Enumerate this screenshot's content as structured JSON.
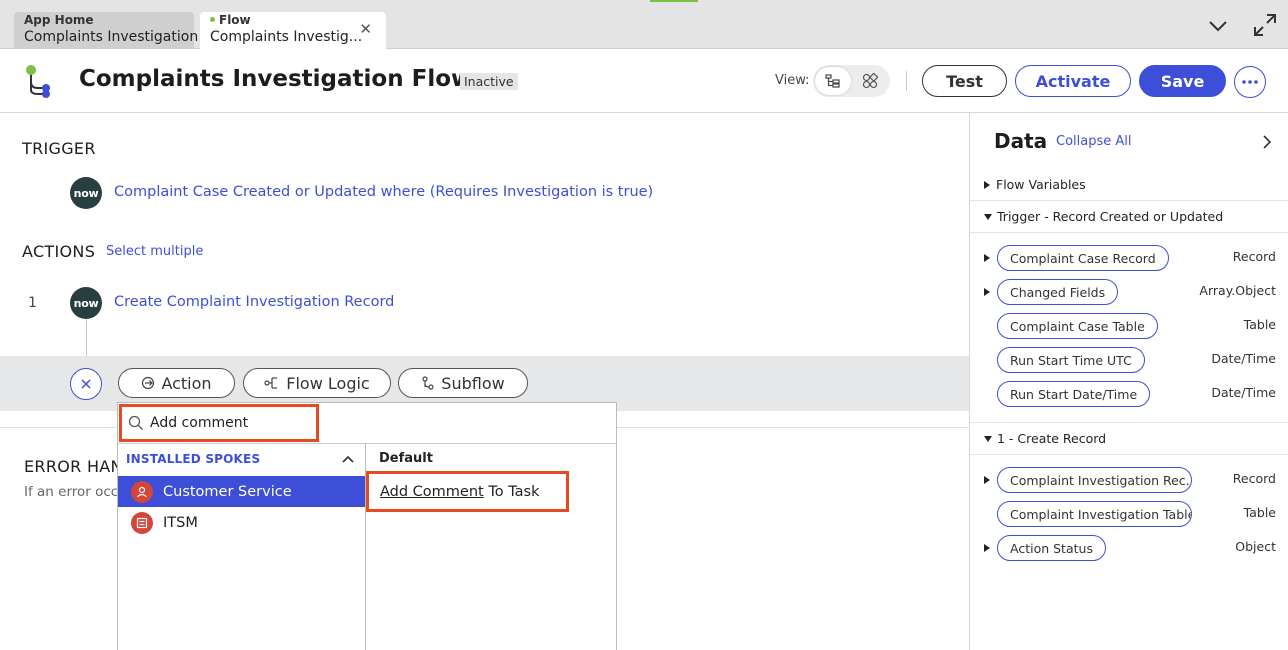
{
  "tabs": [
    {
      "title": "App Home",
      "subtitle": "Complaints Investigation"
    },
    {
      "title": "Flow",
      "subtitle": "Complaints Investig..."
    }
  ],
  "header": {
    "title": "Complaints Investigation Flow",
    "status": "Inactive",
    "view_label": "View:",
    "buttons": {
      "test": "Test",
      "activate": "Activate",
      "save": "Save"
    }
  },
  "trigger": {
    "section": "TRIGGER",
    "badge": "now",
    "label": "Complaint Case Created or Updated where (Requires Investigation is true)"
  },
  "actions": {
    "section": "ACTIONS",
    "select_multiple": "Select multiple",
    "items": [
      {
        "number": "1",
        "badge": "now",
        "label": "Create Complaint Investigation Record"
      }
    ]
  },
  "add_bar": {
    "action": "Action",
    "flow_logic": "Flow Logic",
    "subflow": "Subflow"
  },
  "error_handler": {
    "title": "ERROR HAND",
    "desc": "If an error occ"
  },
  "picker": {
    "search_value": "Add comment",
    "spokes_header": "INSTALLED SPOKES",
    "spokes": [
      "Customer Service",
      "ITSM"
    ],
    "default_header": "Default",
    "result_match": "Add Comment",
    "result_rest": " To Task"
  },
  "data_panel": {
    "title": "Data",
    "collapse_all": "Collapse All",
    "groups": {
      "flow_variables": "Flow Variables",
      "trigger": "Trigger - Record Created or Updated",
      "create_record": "1 - Create Record"
    },
    "trigger_fields": [
      {
        "name": "Complaint Case Record",
        "type": "Record"
      },
      {
        "name": "Changed Fields",
        "type": "Array.Object"
      },
      {
        "name": "Complaint Case Table",
        "type": "Table"
      },
      {
        "name": "Run Start Time UTC",
        "type": "Date/Time"
      },
      {
        "name": "Run Start Date/Time",
        "type": "Date/Time"
      }
    ],
    "create_fields": [
      {
        "name": "Complaint Investigation Rec...",
        "type": "Record"
      },
      {
        "name": "Complaint Investigation Table",
        "type": "Table"
      },
      {
        "name": "Action Status",
        "type": "Object"
      }
    ]
  },
  "colors": {
    "accent": "#3d4fd8",
    "highlight": "#e8491e",
    "now_badge": "#293e40",
    "spoke_icon": "#d4463a"
  }
}
